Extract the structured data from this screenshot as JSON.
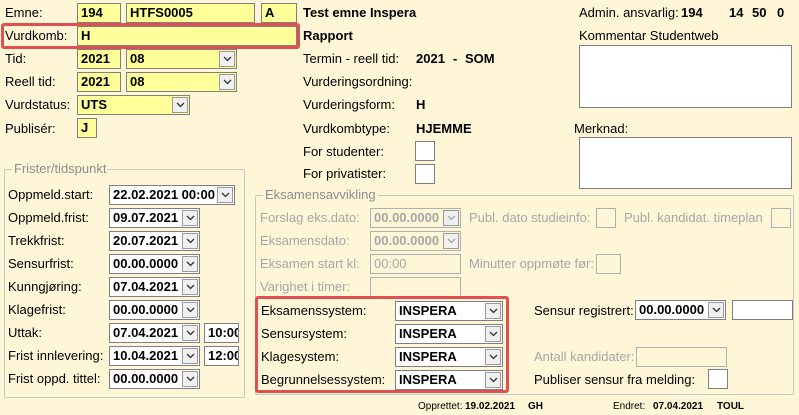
{
  "emne": {
    "label": "Emne:",
    "inst": "194",
    "code": "HTFS0005",
    "version": "A",
    "name": "Test emne Inspera"
  },
  "admin": {
    "label": "Admin. ansvarlig:",
    "inst": "194",
    "fak": "14",
    "inst2": "50",
    "grp": "0"
  },
  "vurdkomb": {
    "label": "Vurdkomb:",
    "value": "H",
    "name": "Rapport"
  },
  "kommentar_label": "Kommentar Studentweb",
  "tid": {
    "label": "Tid:",
    "year": "2021",
    "term": "08"
  },
  "reell_tid": {
    "label": "Reell tid:",
    "year": "2021",
    "term": "08"
  },
  "vurdstatus": {
    "label": "Vurdstatus:",
    "value": "UTS"
  },
  "publiser": {
    "label": "Publisér:",
    "value": "J"
  },
  "termin": {
    "label": "Termin - reell tid:",
    "year": "2021",
    "sep": "-",
    "term": "SOM"
  },
  "vurderingsordning_label": "Vurderingsordning:",
  "vurderingsform": {
    "label": "Vurderingsform:",
    "value": "H"
  },
  "vurdkombtype": {
    "label": "Vurdkombtype:",
    "value": "HJEMME"
  },
  "merknad_label": "Merknad:",
  "for_studenter_label": "For studenter:",
  "for_privatister_label": "For privatister:",
  "frister": {
    "title": "Frister/tidspunkt",
    "oppmeld_start": {
      "label": "Oppmeld.start:",
      "value": "22.02.2021 00:00"
    },
    "oppmeld_frist": {
      "label": "Oppmeld.frist:",
      "value": "09.07.2021"
    },
    "trekkfrist": {
      "label": "Trekkfrist:",
      "value": "20.07.2021"
    },
    "sensurfrist": {
      "label": "Sensurfrist:",
      "value": "00.00.0000"
    },
    "kunngjoring": {
      "label": "Kunngjøring:",
      "value": "07.04.2021"
    },
    "klagefrist": {
      "label": "Klagefrist:",
      "value": "00.00.0000"
    },
    "uttak": {
      "label": "Uttak:",
      "value": "07.04.2021",
      "time": "10:00"
    },
    "frist_innlevering": {
      "label": "Frist innlevering:",
      "value": "10.04.2021",
      "time": "12:00"
    },
    "frist_oppd_tittel": {
      "label": "Frist oppd. tittel:",
      "value": "00.00.0000"
    }
  },
  "eksamen": {
    "title": "Eksamensavvikling",
    "forslag_label": "Forslag eks.dato:",
    "forslag_value": "00.00.0000",
    "publ_dato_label": "Publ. dato studieinfo:",
    "publ_kand_label": "Publ. kandidat. timeplan",
    "eksamensdato_label": "Eksamensdato:",
    "eksamensdato_value": "00.00.0000",
    "start_kl_label": "Eksamen start kl:",
    "start_kl_value": "00:00",
    "minutter_label": "Minutter oppmøte før:",
    "varighet_label": "Varighet i timer:"
  },
  "systems": {
    "eksamenssystem": {
      "label": "Eksamenssystem:",
      "value": "INSPERA"
    },
    "sensursystem": {
      "label": "Sensursystem:",
      "value": "INSPERA"
    },
    "klagesystem": {
      "label": "Klagesystem:",
      "value": "INSPERA"
    },
    "begrunnelsessystem": {
      "label": "Begrunnelsessystem:",
      "value": "INSPERA"
    }
  },
  "sensur_registrert": {
    "label": "Sensur registrert:",
    "value": "00.00.0000"
  },
  "antall_kandidater_label": "Antall kandidater:",
  "publiser_sensur_label": "Publiser sensur fra melding:",
  "footer": {
    "opprettet_label": "Opprettet:",
    "opprettet_date": "19.02.2021",
    "opprettet_user": "GH",
    "endret_label": "Endret:",
    "endret_date": "07.04.2021",
    "endret_user": "TOUL"
  },
  "colors": {
    "yellow_field": "#ffff99",
    "background": "#fff6d8",
    "highlight": "#e05050"
  }
}
